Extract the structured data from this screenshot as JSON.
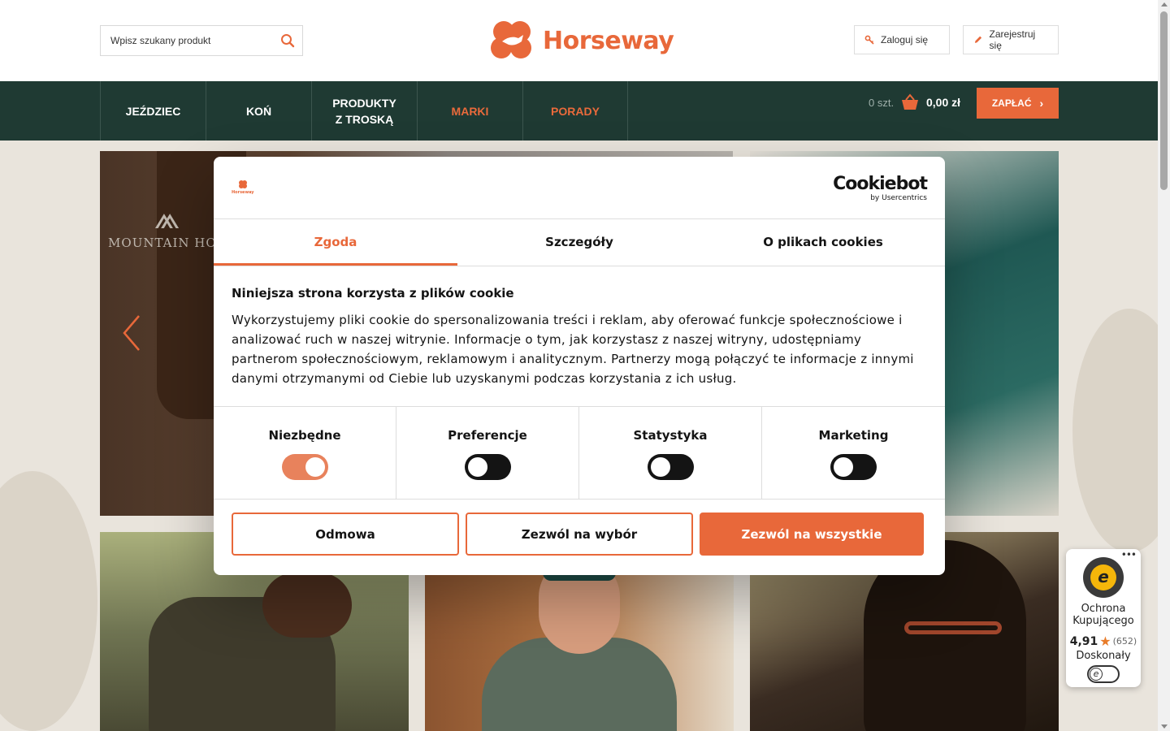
{
  "header": {
    "search_placeholder": "Wpisz szukany produkt",
    "logo_text": "Horseway",
    "login_label": "Zaloguj się",
    "register_label": "Zarejestruj się"
  },
  "nav": {
    "items": [
      {
        "label": "JEŹDZIEC",
        "highlight": false
      },
      {
        "label": "KOŃ",
        "highlight": false
      },
      {
        "label": "PRODUKTY Z TROSKĄ",
        "highlight": false
      },
      {
        "label": "MARKI",
        "highlight": true
      },
      {
        "label": "PORADY",
        "highlight": true
      }
    ],
    "cart_qty": "0 szt.",
    "cart_total": "0,00 zł",
    "pay_label": "ZAPŁAĆ"
  },
  "hero": {
    "brand_text": "MOUNTAIN HOR"
  },
  "cookie": {
    "mini_logo_text": "Horseway",
    "provider_name": "Cookiebot",
    "provider_sub": "by Usercentrics",
    "tabs": [
      "Zgoda",
      "Szczegóły",
      "O plikach cookies"
    ],
    "active_tab": 0,
    "heading": "Niniejsza strona korzysta z plików cookie",
    "body": "Wykorzystujemy pliki cookie do spersonalizowania treści i reklam, aby oferować funkcje społecznościowe i analizować ruch w naszej witrynie. Informacje o tym, jak korzystasz z naszej witryny, udostępniamy partnerom społecznościowym, reklamowym i analitycznym. Partnerzy mogą połączyć te informacje z innymi danymi otrzymanymi od Ciebie lub uzyskanymi podczas korzystania z ich usług.",
    "toggles": [
      {
        "label": "Niezbędne",
        "on": true
      },
      {
        "label": "Preferencje",
        "on": false
      },
      {
        "label": "Statystyka",
        "on": false
      },
      {
        "label": "Marketing",
        "on": false
      }
    ],
    "btn_deny": "Odmowa",
    "btn_allow_selection": "Zezwól na wybór",
    "btn_allow_all": "Zezwól na wszystkie"
  },
  "trusted_shops": {
    "title": "Ochrona Kupującego",
    "score": "4,91",
    "count": "(652)",
    "level": "Doskonały"
  },
  "colors": {
    "brand_orange": "#e8683a",
    "nav_dark_green": "#1f3a33"
  }
}
